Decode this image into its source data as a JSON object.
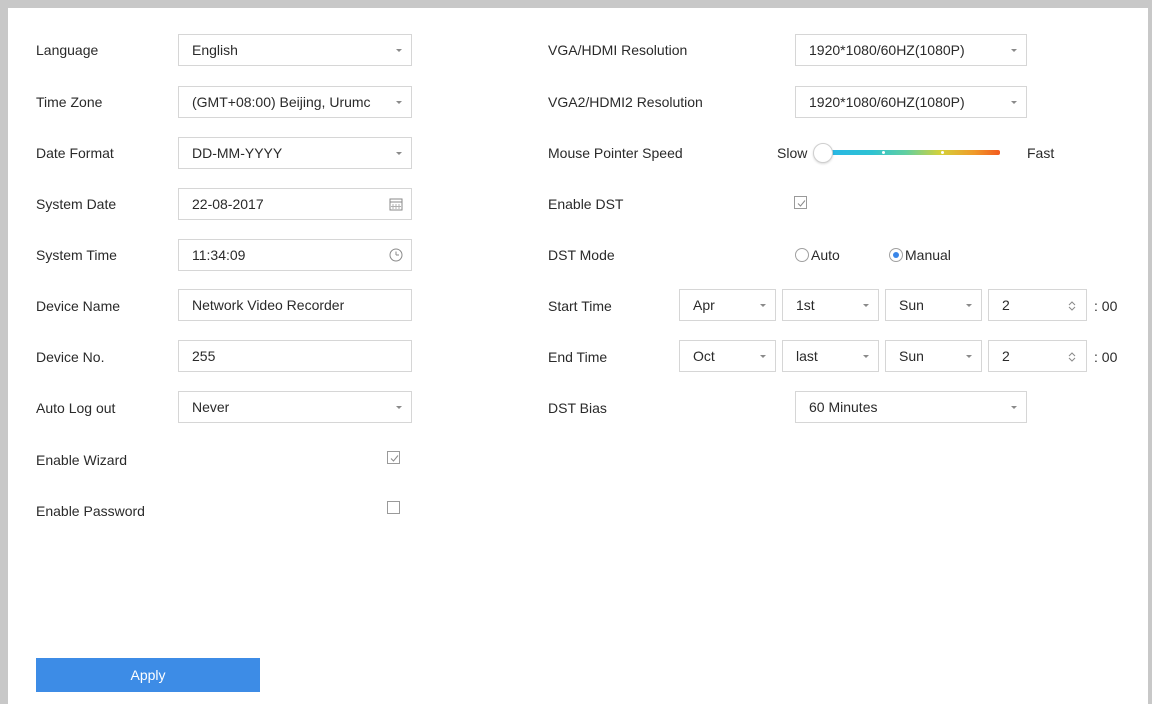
{
  "left": {
    "language": {
      "label": "Language",
      "value": "English"
    },
    "time_zone": {
      "label": "Time Zone",
      "value": "(GMT+08:00) Beijing, Urumc"
    },
    "date_format": {
      "label": "Date Format",
      "value": "DD-MM-YYYY"
    },
    "system_date": {
      "label": "System Date",
      "value": "22-08-2017"
    },
    "system_time": {
      "label": "System Time",
      "value": "11:34:09"
    },
    "device_name": {
      "label": "Device Name",
      "value": "Network Video Recorder"
    },
    "device_no": {
      "label": "Device No.",
      "value": "255"
    },
    "auto_logout": {
      "label": "Auto Log out",
      "value": "Never"
    },
    "enable_wizard": {
      "label": "Enable Wizard",
      "checked": true
    },
    "enable_password": {
      "label": "Enable Password",
      "checked": false
    }
  },
  "right": {
    "vga_hdmi": {
      "label": "VGA/HDMI Resolution",
      "value": "1920*1080/60HZ(1080P)"
    },
    "vga2_hdmi2": {
      "label": "VGA2/HDMI2 Resolution",
      "value": "1920*1080/60HZ(1080P)"
    },
    "mouse_speed": {
      "label": "Mouse Pointer Speed",
      "slow": "Slow",
      "fast": "Fast",
      "level": 0
    },
    "enable_dst": {
      "label": "Enable DST",
      "checked": true
    },
    "dst_mode": {
      "label": "DST Mode",
      "options": [
        "Auto",
        "Manual"
      ],
      "selected": "Manual"
    },
    "start_time": {
      "label": "Start Time",
      "month": "Apr",
      "week": "1st",
      "day": "Sun",
      "hour": "2",
      "suffix": ": 00"
    },
    "end_time": {
      "label": "End Time",
      "month": "Oct",
      "week": "last",
      "day": "Sun",
      "hour": "2",
      "suffix": ": 00"
    },
    "dst_bias": {
      "label": "DST Bias",
      "value": "60 Minutes"
    }
  },
  "apply_label": "Apply",
  "colors": {
    "accent": "#3d8ce6",
    "border": "#d6d6d6",
    "frame": "#c8c8c8"
  }
}
